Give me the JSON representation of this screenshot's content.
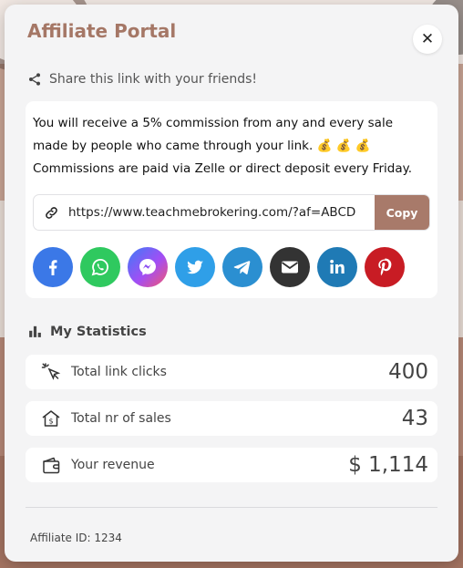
{
  "modal": {
    "title": "Affiliate Portal",
    "close_icon": "close-icon",
    "share_heading": "Share this link with your friends!",
    "message": "You will receive a 5% commission from any and every sale made by people who came through your link. 💰 💰 💰 Commissions are paid via Zelle or direct deposit every Friday.",
    "link_url": "https://www.teachmebrokering.com/?af=ABCD",
    "copy_label": "Copy",
    "socials": [
      {
        "name": "facebook",
        "color": "#3b78e7"
      },
      {
        "name": "whatsapp",
        "color": "#2fc95f"
      },
      {
        "name": "messenger",
        "color": "#9b4ef6"
      },
      {
        "name": "twitter",
        "color": "#2f9fe8"
      },
      {
        "name": "telegram",
        "color": "#2b8fd1"
      },
      {
        "name": "email",
        "color": "#333333"
      },
      {
        "name": "linkedin",
        "color": "#1f7ab5"
      },
      {
        "name": "pinterest",
        "color": "#c81c24"
      }
    ],
    "stats_heading": "My Statistics",
    "stats": [
      {
        "label": "Total link clicks",
        "value": "400",
        "icon": "click-cursor-icon"
      },
      {
        "label": "Total nr of sales",
        "value": "43",
        "icon": "house-dollar-icon"
      },
      {
        "label": "Your revenue",
        "value": "$ 1,114",
        "icon": "wallet-icon"
      }
    ],
    "affiliate_id": "Affiliate ID: 1234"
  },
  "colors": {
    "accent": "#a87a6a",
    "title": "#a57766",
    "panel": "#f4f4f5"
  }
}
